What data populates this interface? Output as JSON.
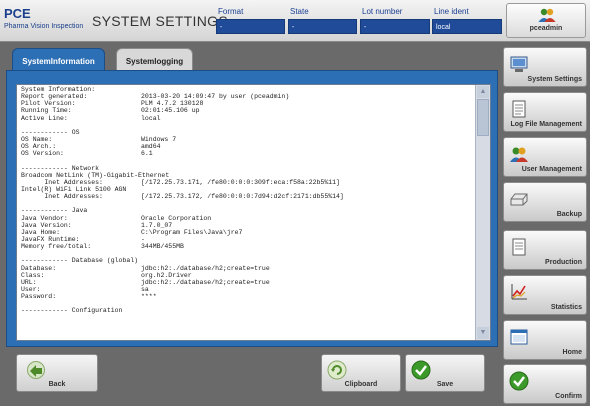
{
  "header": {
    "logo_name": "PCE",
    "logo_sub": "Pharma Vision Inspection",
    "title": "SYSTEM SETTINGS",
    "fields": [
      {
        "label": "Format",
        "value": "-"
      },
      {
        "label": "State",
        "value": "-"
      },
      {
        "label": "Lot number",
        "value": "-"
      },
      {
        "label": "Line ident",
        "value": "local"
      }
    ],
    "user": {
      "name": "pceadmin",
      "icon": "users-icon"
    }
  },
  "tabs": [
    {
      "label": "SystemInformation",
      "active": true
    },
    {
      "label": "Systemlogging",
      "active": false
    }
  ],
  "info_lines": [
    {
      "k": "System Information:",
      "v": ""
    },
    {
      "k": "Report generated:",
      "v": "2013-03-20 14:09:47 by user (pceadmin)"
    },
    {
      "k": "Pilot Version:",
      "v": "PLM 4.7.2 130128"
    },
    {
      "k": "Running Time:",
      "v": "02:01:45.106 up"
    },
    {
      "k": "Active Line:",
      "v": "local"
    },
    {
      "k": "",
      "v": ""
    },
    {
      "k": "------------ OS",
      "v": ""
    },
    {
      "k": "OS Name:",
      "v": "Windows 7"
    },
    {
      "k": "OS Arch.:",
      "v": "amd64"
    },
    {
      "k": "OS Version:",
      "v": "6.1"
    },
    {
      "k": "",
      "v": ""
    },
    {
      "k": "------------ Network",
      "v": ""
    },
    {
      "k": "Broadcom NetLink (TM)-Gigabit-Ethernet",
      "v": ""
    },
    {
      "k": "      Inet Addresses:",
      "v": "[/172.25.73.171, /fe80:0:0:0:309f:eca:f58a:22b5%11]"
    },
    {
      "k": "Intel(R) WiFi Link 5100 AGN",
      "v": ""
    },
    {
      "k": "      Inet Addresses:",
      "v": "[/172.25.73.172, /fe80:0:0:0:7d94:d2cf:2171:db55%14]"
    },
    {
      "k": "",
      "v": ""
    },
    {
      "k": "------------ Java",
      "v": ""
    },
    {
      "k": "Java Vendor:",
      "v": "Oracle Corporation"
    },
    {
      "k": "Java Version:",
      "v": "1.7.0_07"
    },
    {
      "k": "Java Home:",
      "v": "C:\\Program Files\\Java\\jre7"
    },
    {
      "k": "JavaFX Runtime:",
      "v": "-"
    },
    {
      "k": "Memory free/total:",
      "v": "344MB/455MB"
    },
    {
      "k": "",
      "v": ""
    },
    {
      "k": "------------ Database (global)",
      "v": ""
    },
    {
      "k": "Database:",
      "v": "jdbc:h2:./database/h2;create=true"
    },
    {
      "k": "Class:",
      "v": "org.h2.Driver"
    },
    {
      "k": "URL:",
      "v": "jdbc:h2:./database/h2;create=true"
    },
    {
      "k": "User:",
      "v": "sa"
    },
    {
      "k": "Password:",
      "v": "****"
    },
    {
      "k": "",
      "v": ""
    },
    {
      "k": "------------ Configuration",
      "v": ""
    }
  ],
  "buttons": {
    "back": "Back",
    "clipboard": "Clipboard",
    "save": "Save"
  },
  "sidebar": [
    {
      "label": "System Settings",
      "icon": "computer-icon"
    },
    {
      "label": "Log File Management",
      "icon": "document-icon"
    },
    {
      "label": "User Management",
      "icon": "users-icon"
    },
    {
      "label": "Backup",
      "icon": "drive-icon"
    },
    {
      "label": "Production",
      "icon": "document-icon"
    },
    {
      "label": "Statistics",
      "icon": "chart-icon"
    },
    {
      "label": "Home",
      "icon": "window-icon"
    },
    {
      "label": "Confirm",
      "icon": "check-icon"
    }
  ]
}
